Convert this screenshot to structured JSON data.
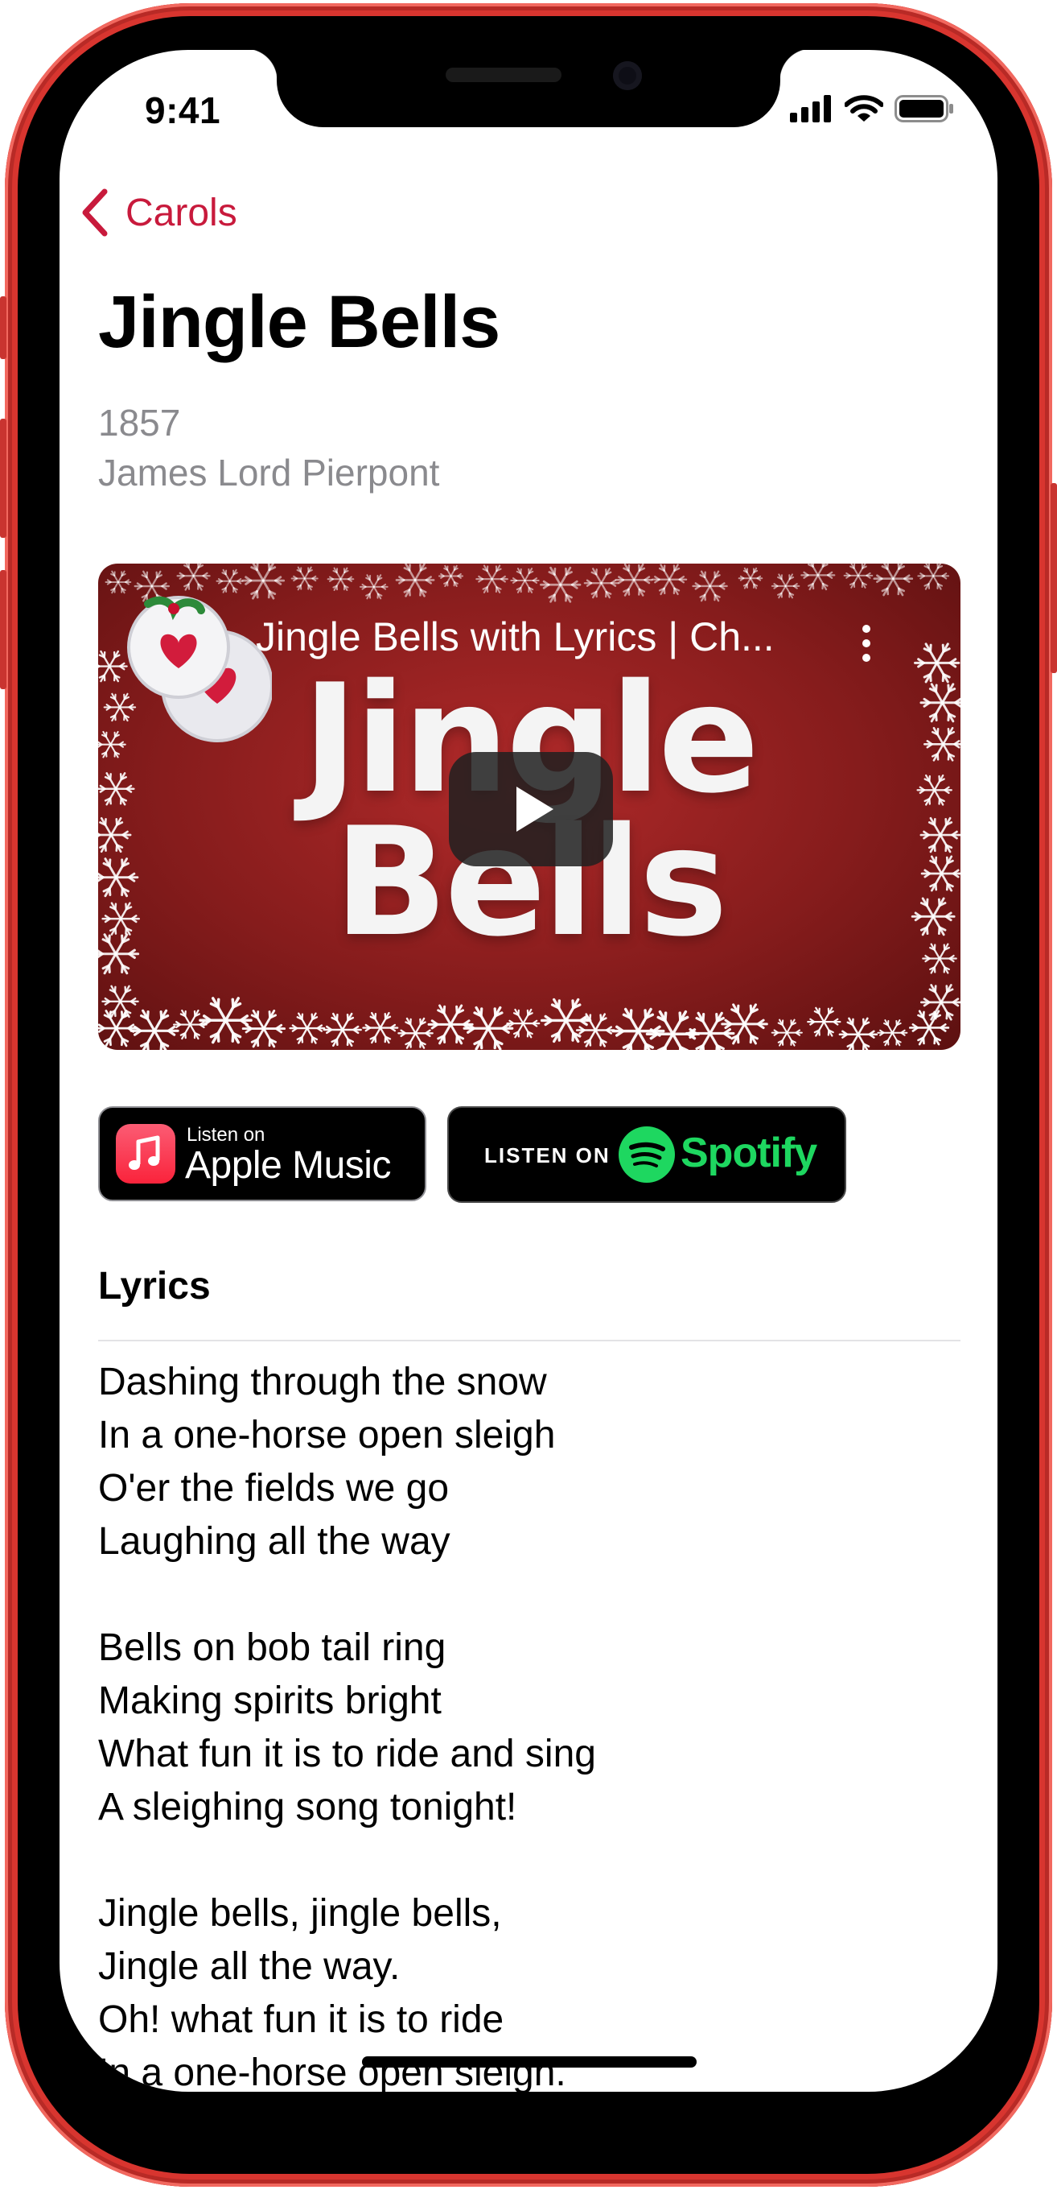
{
  "status_bar": {
    "time": "9:41"
  },
  "nav": {
    "back_label": "Carols"
  },
  "song": {
    "title": "Jingle Bells",
    "year": "1857",
    "composer": "James Lord Pierpont"
  },
  "video": {
    "title": "Jingle Bells with Lyrics | Ch...",
    "thumbnail_line1": "Jingle",
    "thumbnail_line2": "Bells"
  },
  "buttons": {
    "apple_music_small": "Listen on",
    "apple_music_big": "Apple Music",
    "spotify_small": "LISTEN ON",
    "spotify_word": "Spotify"
  },
  "lyrics": {
    "heading": "Lyrics",
    "stanzas": [
      [
        "Dashing through the snow",
        "In a one-horse open sleigh",
        "O'er the fields we go",
        "Laughing all the way"
      ],
      [
        "Bells on bob tail ring",
        "Making spirits bright",
        "What fun it is to ride and sing",
        "A sleighing song tonight!"
      ],
      [
        "Jingle bells, jingle bells,",
        "Jingle all the way.",
        "Oh! what fun it is to ride",
        "In a one-horse open sleigh."
      ]
    ]
  },
  "colors": {
    "accent": "#c81a3c",
    "frame": "#d8352f",
    "spotify_green": "#1ed760",
    "apple_music": "#fa233b"
  }
}
